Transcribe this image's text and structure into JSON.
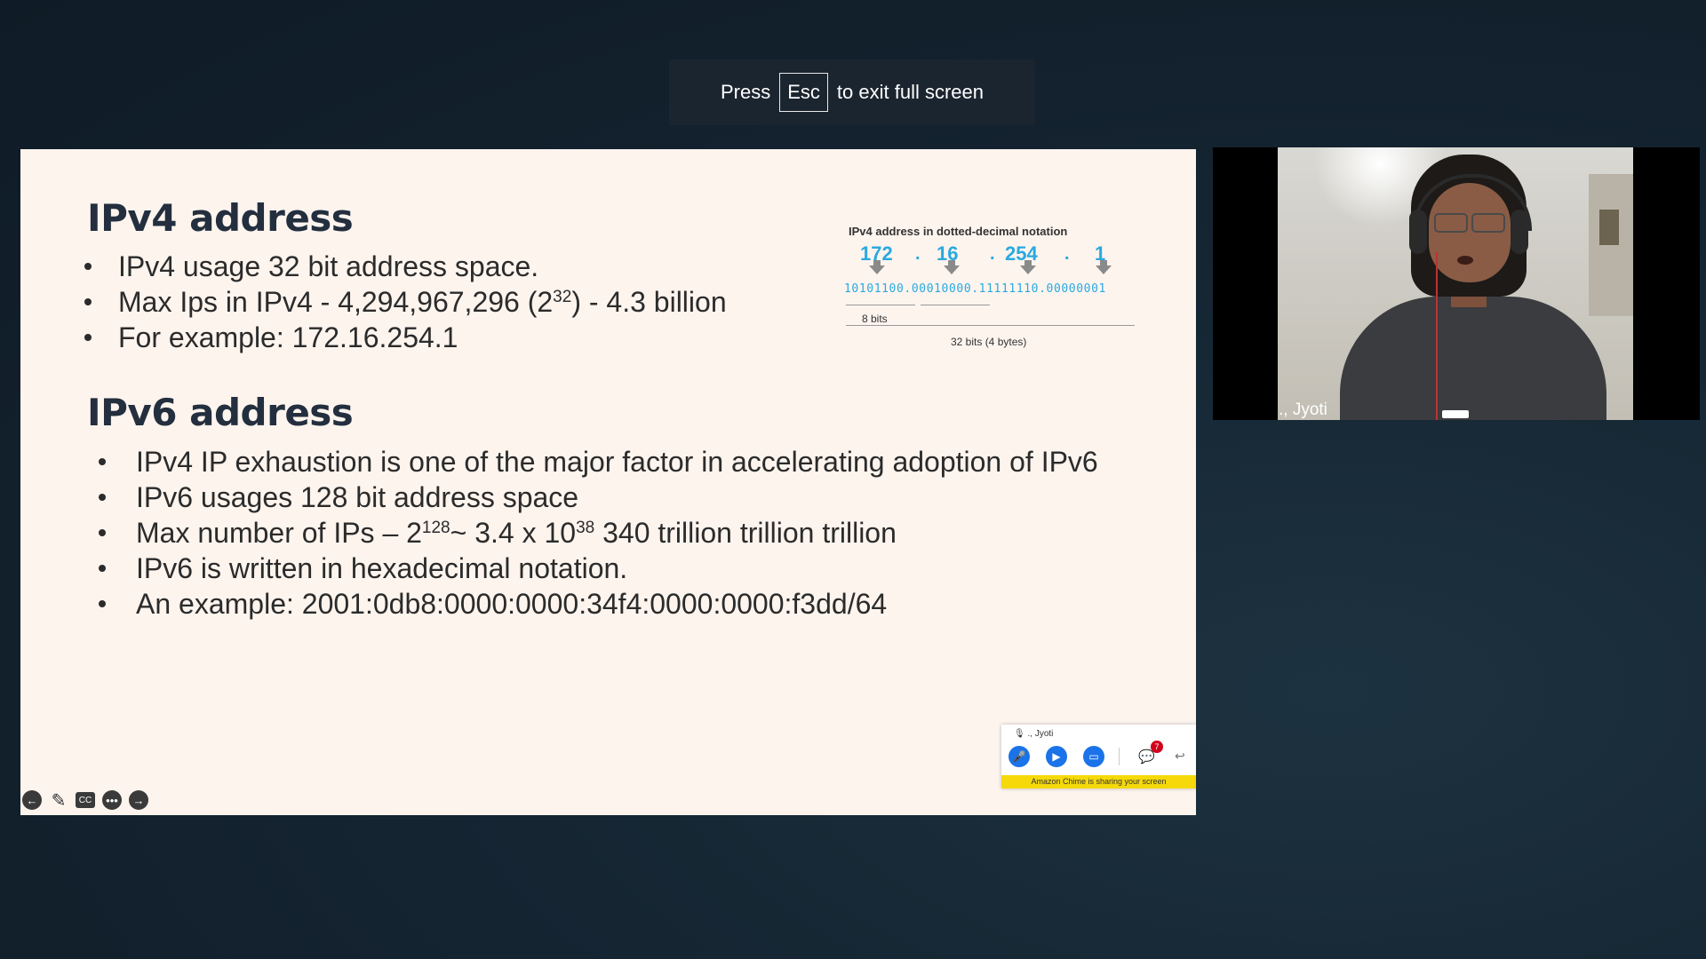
{
  "fullscreen_toast": {
    "prefix": "Press",
    "key": "Esc",
    "suffix": "to exit full screen"
  },
  "slide": {
    "ipv4": {
      "heading": "IPv4 address",
      "bullets": [
        {
          "text": "IPv4 usage 32 bit address space."
        },
        {
          "before": "Max Ips in IPv4 - 4,294,967,296 (2",
          "sup": "32",
          "after": ") - 4.3 billion"
        },
        {
          "text": "For example: 172.16.254.1"
        }
      ]
    },
    "diagram": {
      "title": "IPv4 address in dotted-decimal notation",
      "octets": [
        "172",
        "16",
        "254",
        "1"
      ],
      "dot": ".",
      "bits": "10101100.00010000.11111110.00000001",
      "byte_label": "8 bits",
      "total_label": "32 bits (4 bytes)"
    },
    "ipv6": {
      "heading": "IPv6 address",
      "bullets": [
        {
          "text": "IPv4 IP exhaustion is one of the major factor in accelerating adoption of IPv6"
        },
        {
          "text": "IPv6 usages 128 bit address space"
        },
        {
          "before": "Max number of IPs – 2",
          "sup1": "128",
          "middle": "~ 3.4 x 10",
          "sup2": "38",
          "after": " 340 trillion trillion trillion"
        },
        {
          "text": "IPv6 is written in hexadecimal notation."
        },
        {
          "text": "An example: 2001:0db8:0000:0000:34f4:0000:0000:f3dd/64"
        }
      ]
    },
    "controls": {
      "prev": "←",
      "pen": "✎",
      "cc": "CC",
      "more": "•••",
      "next": "→"
    }
  },
  "chime_bar": {
    "presenter": "., Jyoti",
    "chat_badge": "7",
    "banner": "Amazon Chime is sharing your screen",
    "colors": {
      "button": "#1a73e8",
      "banner": "#f5d90a",
      "badge": "#d0021b"
    }
  },
  "video_tile": {
    "name": "., Jyoti"
  }
}
